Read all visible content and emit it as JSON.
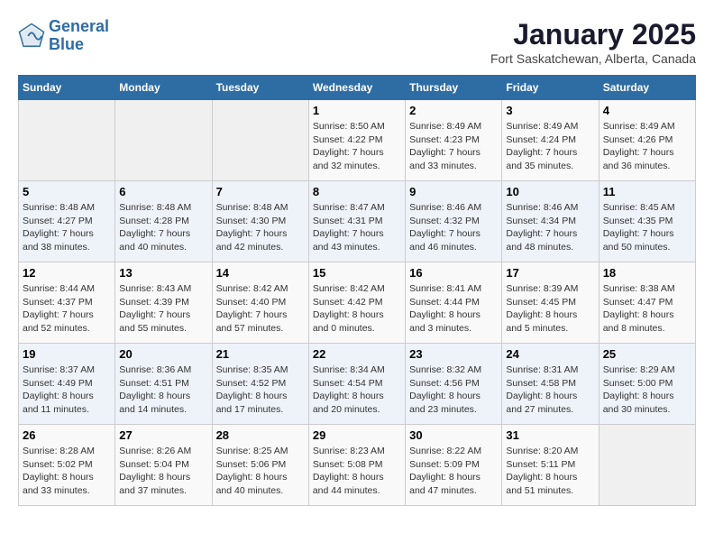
{
  "logo": {
    "line1": "General",
    "line2": "Blue"
  },
  "title": "January 2025",
  "subtitle": "Fort Saskatchewan, Alberta, Canada",
  "weekdays": [
    "Sunday",
    "Monday",
    "Tuesday",
    "Wednesday",
    "Thursday",
    "Friday",
    "Saturday"
  ],
  "weeks": [
    [
      {
        "day": "",
        "detail": ""
      },
      {
        "day": "",
        "detail": ""
      },
      {
        "day": "",
        "detail": ""
      },
      {
        "day": "1",
        "detail": "Sunrise: 8:50 AM\nSunset: 4:22 PM\nDaylight: 7 hours\nand 32 minutes."
      },
      {
        "day": "2",
        "detail": "Sunrise: 8:49 AM\nSunset: 4:23 PM\nDaylight: 7 hours\nand 33 minutes."
      },
      {
        "day": "3",
        "detail": "Sunrise: 8:49 AM\nSunset: 4:24 PM\nDaylight: 7 hours\nand 35 minutes."
      },
      {
        "day": "4",
        "detail": "Sunrise: 8:49 AM\nSunset: 4:26 PM\nDaylight: 7 hours\nand 36 minutes."
      }
    ],
    [
      {
        "day": "5",
        "detail": "Sunrise: 8:48 AM\nSunset: 4:27 PM\nDaylight: 7 hours\nand 38 minutes."
      },
      {
        "day": "6",
        "detail": "Sunrise: 8:48 AM\nSunset: 4:28 PM\nDaylight: 7 hours\nand 40 minutes."
      },
      {
        "day": "7",
        "detail": "Sunrise: 8:48 AM\nSunset: 4:30 PM\nDaylight: 7 hours\nand 42 minutes."
      },
      {
        "day": "8",
        "detail": "Sunrise: 8:47 AM\nSunset: 4:31 PM\nDaylight: 7 hours\nand 43 minutes."
      },
      {
        "day": "9",
        "detail": "Sunrise: 8:46 AM\nSunset: 4:32 PM\nDaylight: 7 hours\nand 46 minutes."
      },
      {
        "day": "10",
        "detail": "Sunrise: 8:46 AM\nSunset: 4:34 PM\nDaylight: 7 hours\nand 48 minutes."
      },
      {
        "day": "11",
        "detail": "Sunrise: 8:45 AM\nSunset: 4:35 PM\nDaylight: 7 hours\nand 50 minutes."
      }
    ],
    [
      {
        "day": "12",
        "detail": "Sunrise: 8:44 AM\nSunset: 4:37 PM\nDaylight: 7 hours\nand 52 minutes."
      },
      {
        "day": "13",
        "detail": "Sunrise: 8:43 AM\nSunset: 4:39 PM\nDaylight: 7 hours\nand 55 minutes."
      },
      {
        "day": "14",
        "detail": "Sunrise: 8:42 AM\nSunset: 4:40 PM\nDaylight: 7 hours\nand 57 minutes."
      },
      {
        "day": "15",
        "detail": "Sunrise: 8:42 AM\nSunset: 4:42 PM\nDaylight: 8 hours\nand 0 minutes."
      },
      {
        "day": "16",
        "detail": "Sunrise: 8:41 AM\nSunset: 4:44 PM\nDaylight: 8 hours\nand 3 minutes."
      },
      {
        "day": "17",
        "detail": "Sunrise: 8:39 AM\nSunset: 4:45 PM\nDaylight: 8 hours\nand 5 minutes."
      },
      {
        "day": "18",
        "detail": "Sunrise: 8:38 AM\nSunset: 4:47 PM\nDaylight: 8 hours\nand 8 minutes."
      }
    ],
    [
      {
        "day": "19",
        "detail": "Sunrise: 8:37 AM\nSunset: 4:49 PM\nDaylight: 8 hours\nand 11 minutes."
      },
      {
        "day": "20",
        "detail": "Sunrise: 8:36 AM\nSunset: 4:51 PM\nDaylight: 8 hours\nand 14 minutes."
      },
      {
        "day": "21",
        "detail": "Sunrise: 8:35 AM\nSunset: 4:52 PM\nDaylight: 8 hours\nand 17 minutes."
      },
      {
        "day": "22",
        "detail": "Sunrise: 8:34 AM\nSunset: 4:54 PM\nDaylight: 8 hours\nand 20 minutes."
      },
      {
        "day": "23",
        "detail": "Sunrise: 8:32 AM\nSunset: 4:56 PM\nDaylight: 8 hours\nand 23 minutes."
      },
      {
        "day": "24",
        "detail": "Sunrise: 8:31 AM\nSunset: 4:58 PM\nDaylight: 8 hours\nand 27 minutes."
      },
      {
        "day": "25",
        "detail": "Sunrise: 8:29 AM\nSunset: 5:00 PM\nDaylight: 8 hours\nand 30 minutes."
      }
    ],
    [
      {
        "day": "26",
        "detail": "Sunrise: 8:28 AM\nSunset: 5:02 PM\nDaylight: 8 hours\nand 33 minutes."
      },
      {
        "day": "27",
        "detail": "Sunrise: 8:26 AM\nSunset: 5:04 PM\nDaylight: 8 hours\nand 37 minutes."
      },
      {
        "day": "28",
        "detail": "Sunrise: 8:25 AM\nSunset: 5:06 PM\nDaylight: 8 hours\nand 40 minutes."
      },
      {
        "day": "29",
        "detail": "Sunrise: 8:23 AM\nSunset: 5:08 PM\nDaylight: 8 hours\nand 44 minutes."
      },
      {
        "day": "30",
        "detail": "Sunrise: 8:22 AM\nSunset: 5:09 PM\nDaylight: 8 hours\nand 47 minutes."
      },
      {
        "day": "31",
        "detail": "Sunrise: 8:20 AM\nSunset: 5:11 PM\nDaylight: 8 hours\nand 51 minutes."
      },
      {
        "day": "",
        "detail": ""
      }
    ]
  ]
}
